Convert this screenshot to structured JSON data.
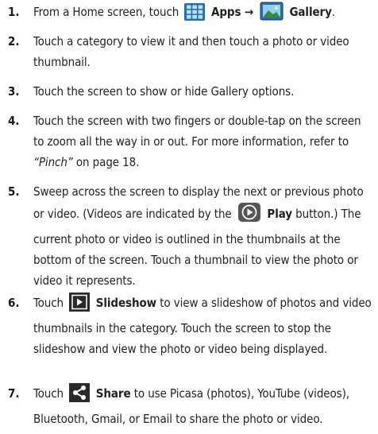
{
  "steps": [
    {
      "num": "1.",
      "parts": [
        {
          "t": "From a Home screen, touch "
        },
        {
          "icon": "apps-icon"
        },
        {
          "t": " Apps → ",
          "b": true
        },
        {
          "icon": "gallery-icon"
        },
        {
          "t": " Gallery",
          "b": true
        },
        {
          "t": "."
        }
      ]
    },
    {
      "num": "2.",
      "parts": [
        {
          "t": "Touch a category to view it and then touch a photo or video thumbnail."
        }
      ]
    },
    {
      "num": "3.",
      "parts": [
        {
          "t": "Touch the screen to show or hide Gallery options."
        }
      ]
    },
    {
      "num": "4.",
      "parts": [
        {
          "t": "Touch the screen with two fingers or double-tap on the screen to zoom all the way in or out. For more information, refer to "
        },
        {
          "t": "“Pinch”",
          "i": true
        },
        {
          "t": " on page 18."
        }
      ]
    },
    {
      "num": "5.",
      "parts": [
        {
          "t": "Sweep across the screen to display the next or previous photo or video. (Videos are indicated by the "
        },
        {
          "icon": "play-icon"
        },
        {
          "t": " Play",
          "b": true
        },
        {
          "t": " button.) The current photo or video is outlined in the thumbnails at the bottom of the screen. Touch a thumbnail to view the photo or video it represents."
        }
      ]
    },
    {
      "num": "6.",
      "parts": [
        {
          "t": "Touch "
        },
        {
          "icon": "slideshow-icon"
        },
        {
          "t": " Slideshow",
          "b": true
        },
        {
          "t": " to view a slideshow of photos and video thumbnails in the category. Touch the screen to stop the slideshow and view the photo or video being displayed."
        }
      ]
    },
    {
      "num": "7.",
      "parts": [
        {
          "t": "Touch "
        },
        {
          "icon": "share-icon"
        },
        {
          "t": " Share",
          "b": true
        },
        {
          "t": " to use Picasa (photos), YouTube (videos), Bluetooth, Gmail, or Email to share the photo or video."
        }
      ]
    }
  ]
}
